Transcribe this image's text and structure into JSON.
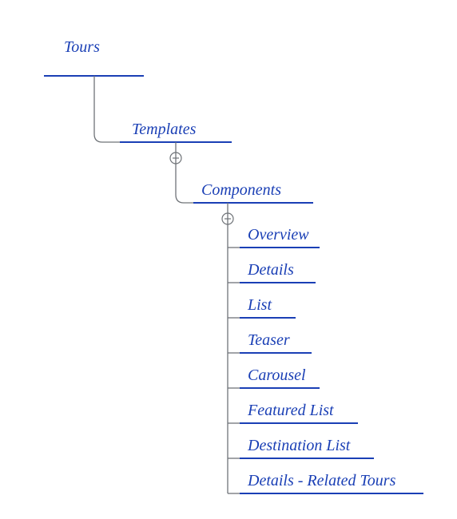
{
  "tree": {
    "root": {
      "label": "Tours"
    },
    "templates": {
      "label": "Templates"
    },
    "components": {
      "label": "Components"
    },
    "leaves": [
      {
        "label": "Overview"
      },
      {
        "label": "Details"
      },
      {
        "label": "List"
      },
      {
        "label": "Teaser"
      },
      {
        "label": "Carousel"
      },
      {
        "label": "Featured List"
      },
      {
        "label": "Destination List"
      },
      {
        "label": "Details - Related Tours"
      }
    ]
  },
  "colors": {
    "ink": "#1a3fb5",
    "connector": "#6f7378",
    "background": "#ffffff"
  }
}
